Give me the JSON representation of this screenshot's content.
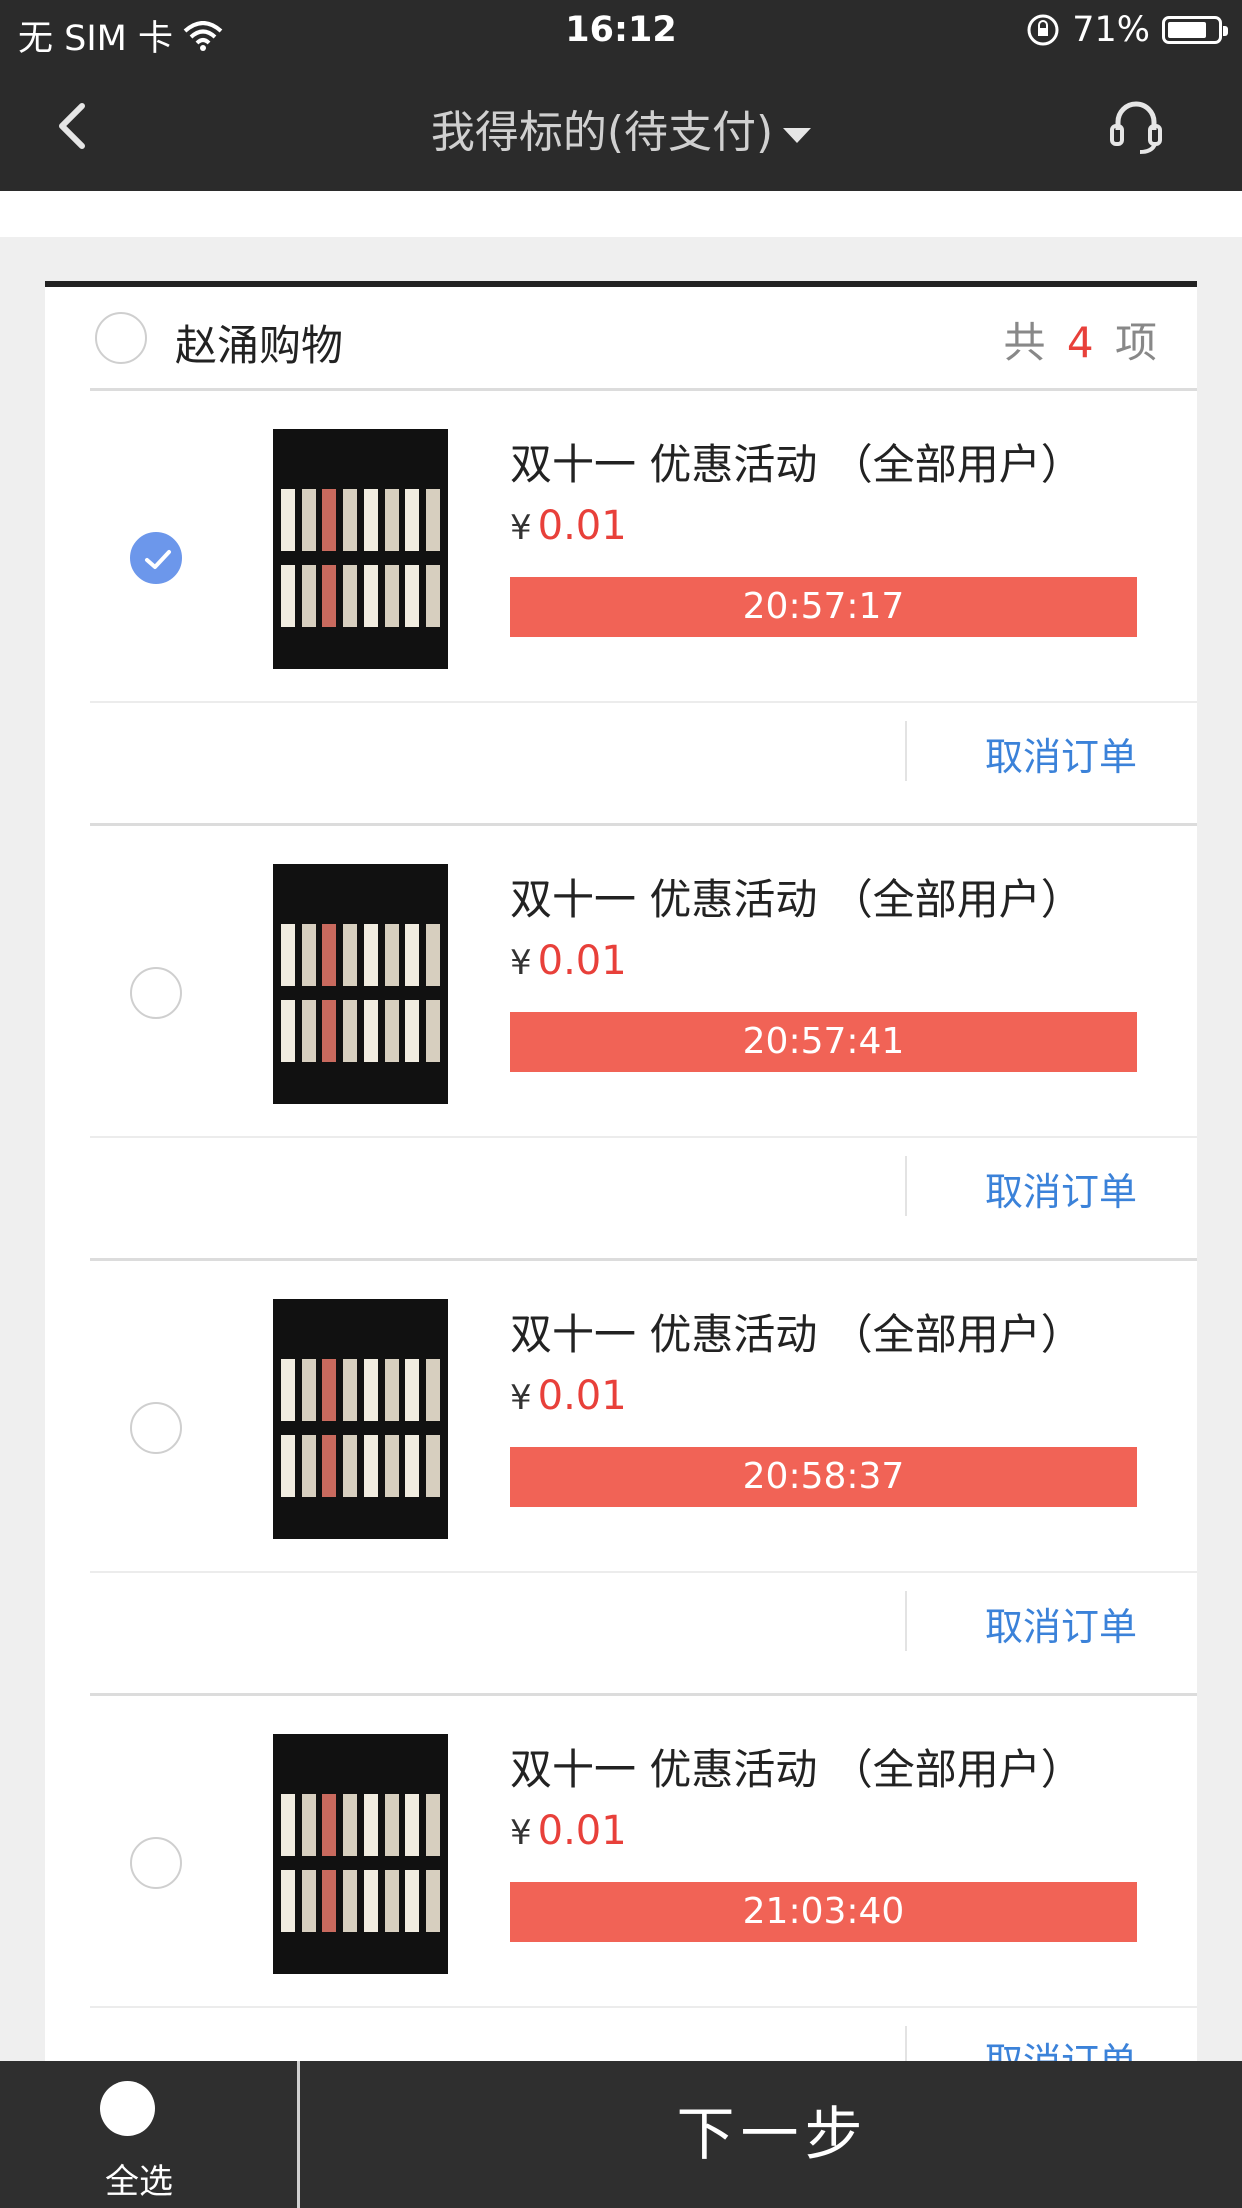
{
  "status_bar": {
    "carrier": "无 SIM 卡",
    "time": "16:12",
    "battery": "71%",
    "battery_level": 0.71
  },
  "nav": {
    "title": "我得标的(待支付)"
  },
  "shop": {
    "name": "赵涌购物",
    "count_prefix": "共",
    "count": "4",
    "count_suffix": "项"
  },
  "orders": [
    {
      "title": "双十一 优惠活动 （全部用户）",
      "currency": "¥",
      "price": "0.01",
      "timer": "20:57:17",
      "cancel_label": "取消订单",
      "checked": true
    },
    {
      "title": "双十一 优惠活动 （全部用户）",
      "currency": "¥",
      "price": "0.01",
      "timer": "20:57:41",
      "cancel_label": "取消订单",
      "checked": false
    },
    {
      "title": "双十一 优惠活动 （全部用户）",
      "currency": "¥",
      "price": "0.01",
      "timer": "20:58:37",
      "cancel_label": "取消订单",
      "checked": false
    },
    {
      "title": "双十一 优惠活动 （全部用户）",
      "currency": "¥",
      "price": "0.01",
      "timer": "21:03:40",
      "cancel_label": "取消订单",
      "checked": false
    }
  ],
  "bottom": {
    "select_all_label": "全选",
    "next_label": "下一步"
  },
  "colors": {
    "accent_red": "#f16356",
    "price_red": "#e8403a",
    "link_blue": "#3b82d9",
    "check_blue": "#6c97eb",
    "bar_dark": "#2b2b2b"
  }
}
